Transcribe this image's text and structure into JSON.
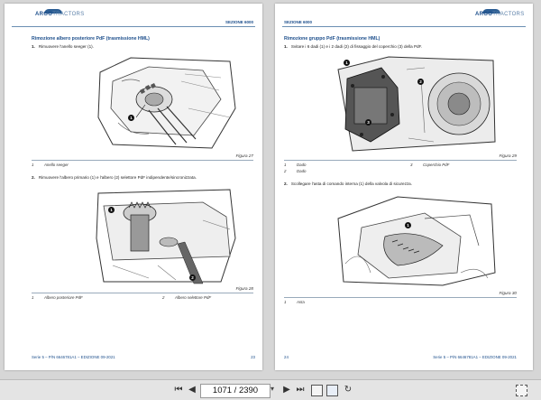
{
  "viewer": {
    "page_indicator": "1071 / 2390",
    "icons": [
      "first-page-icon",
      "prev-page-icon",
      "next-page-icon",
      "last-page-icon",
      "dropdown-icon",
      "fit-page-icon",
      "fit-width-icon",
      "rotate-icon",
      "fullscreen-icon"
    ],
    "accent_color": "#1d4f8c"
  },
  "left_page": {
    "logo": {
      "part1": "ARGO",
      "part2": "TRACTORS"
    },
    "section": "SEZIONE 6000",
    "title": "Rimozione albero posteriore PdF (trasmissione HML)",
    "step1": {
      "num": "1.",
      "text": "Rimuovere l'anello seeger (1)."
    },
    "fig1_caption": "Figura 27",
    "legend1": [
      {
        "n": "1",
        "t": "Anello seeger"
      }
    ],
    "step2": {
      "num": "2.",
      "text": "Rimuovere l'albero primario (1) e l'albero (2) selettore PdF indipendente/sincronizzata."
    },
    "fig2_caption": "Figura 28",
    "legend2": [
      {
        "n": "1",
        "t": "Albero posteriore PdF"
      },
      {
        "n": "2",
        "t": "Albero selettore PdF"
      }
    ],
    "callouts": [
      "1",
      "1",
      "2"
    ],
    "footer_left": "Serie 5 – P/N 6646781A1 – EDIZIONE 09-2021",
    "page_no": "23"
  },
  "right_page": {
    "section": "SEZIONE 6000",
    "title": "Rimozione gruppo PdF (trasmissione HML)",
    "step1": {
      "num": "1.",
      "text": "Svitare i 6 dadi (1) e i 2 dadi (2) di fissaggio del coperchio (3) della PdF."
    },
    "fig1_caption": "Figura 29",
    "legend1": [
      {
        "n": "1",
        "t": "Dado"
      },
      {
        "n": "3",
        "t": "Coperchio PdF"
      },
      {
        "n": "2",
        "t": "Dado"
      }
    ],
    "step2": {
      "num": "2.",
      "text": "Scollegare l'asta di comando interna (1) della valvola di sicurezza."
    },
    "fig2_caption": "Figura 30",
    "legend2": [
      {
        "n": "1",
        "t": "Asta"
      }
    ],
    "callouts": [
      "1",
      "2",
      "3",
      "1"
    ],
    "page_no": "24",
    "footer_right": "Serie 5 – P/N 6646781A1 – EDIZIONE 09-2021"
  }
}
